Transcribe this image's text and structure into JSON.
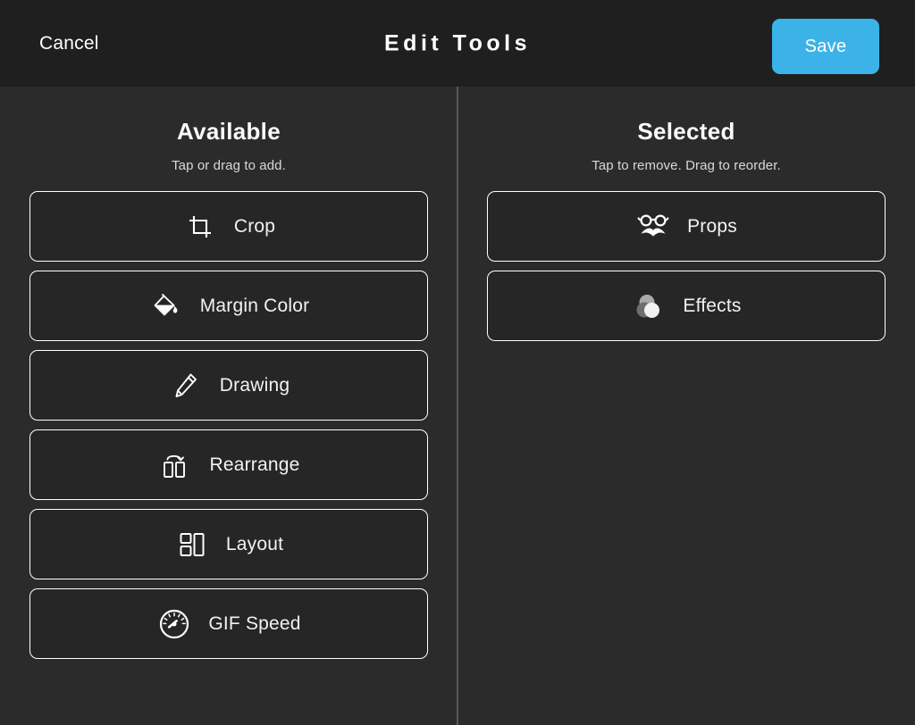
{
  "header": {
    "cancel_label": "Cancel",
    "title": "Edit Tools",
    "save_label": "Save",
    "save_color": "#3bb3e8"
  },
  "columns": {
    "available": {
      "title": "Available",
      "subtitle": "Tap or drag to add.",
      "items": [
        {
          "label": "Crop",
          "icon": "crop-icon"
        },
        {
          "label": "Margin Color",
          "icon": "paint-bucket-icon"
        },
        {
          "label": "Drawing",
          "icon": "pencil-icon"
        },
        {
          "label": "Rearrange",
          "icon": "rearrange-icon"
        },
        {
          "label": "Layout",
          "icon": "layout-icon"
        },
        {
          "label": "GIF Speed",
          "icon": "speedometer-icon"
        }
      ]
    },
    "selected": {
      "title": "Selected",
      "subtitle": "Tap to remove. Drag to reorder.",
      "items": [
        {
          "label": "Props",
          "icon": "glasses-mustache-icon"
        },
        {
          "label": "Effects",
          "icon": "overlapping-circles-icon"
        }
      ]
    }
  },
  "theme": {
    "header_bg": "#1f1f1f",
    "body_bg": "#2b2b2b",
    "card_bg": "#262626",
    "border": "#ffffff",
    "divider": "#585858"
  }
}
